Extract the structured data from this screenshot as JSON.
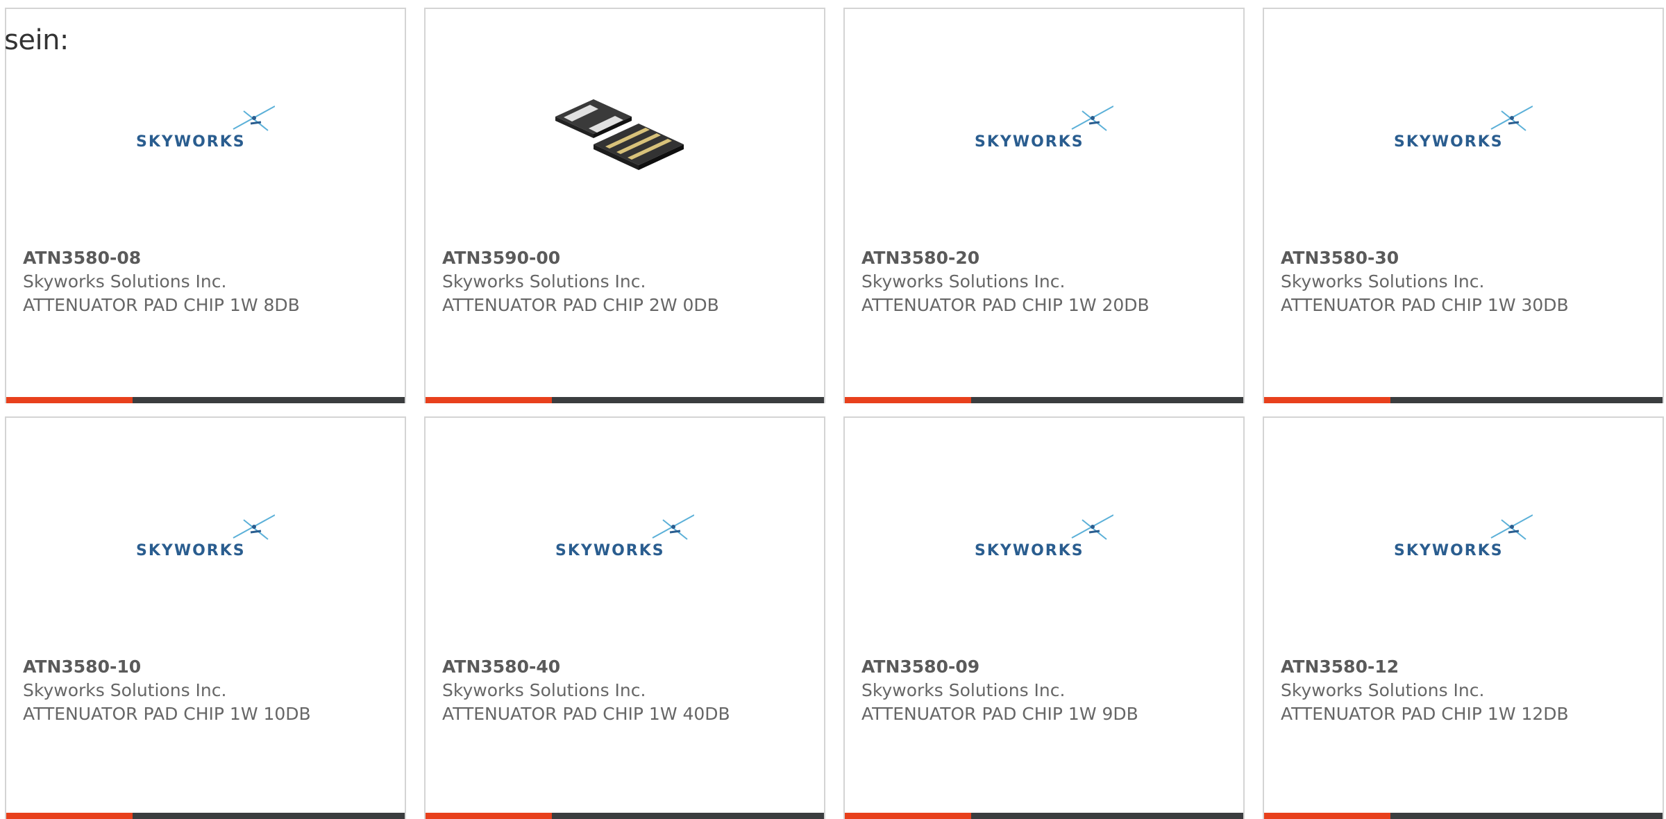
{
  "intro_text": "sein:",
  "brand": "SKYWORKS",
  "colors": {
    "accent": "#e8401c",
    "bar_dark": "#3b3d3f",
    "logo_blue": "#2a5d8f",
    "text": "#666666",
    "border": "#d4d4d4"
  },
  "products": [
    {
      "part_number": "ATN3580-08",
      "manufacturer": "Skyworks Solutions Inc.",
      "description": "ATTENUATOR PAD CHIP 1W 8DB",
      "image": "skyworks-logo"
    },
    {
      "part_number": "ATN3590-00",
      "manufacturer": "Skyworks Solutions Inc.",
      "description": "ATTENUATOR PAD CHIP 2W 0DB",
      "image": "chip-component"
    },
    {
      "part_number": "ATN3580-20",
      "manufacturer": "Skyworks Solutions Inc.",
      "description": "ATTENUATOR PAD CHIP 1W 20DB",
      "image": "skyworks-logo"
    },
    {
      "part_number": "ATN3580-30",
      "manufacturer": "Skyworks Solutions Inc.",
      "description": "ATTENUATOR PAD CHIP 1W 30DB",
      "image": "skyworks-logo"
    },
    {
      "part_number": "ATN3580-10",
      "manufacturer": "Skyworks Solutions Inc.",
      "description": "ATTENUATOR PAD CHIP 1W 10DB",
      "image": "skyworks-logo"
    },
    {
      "part_number": "ATN3580-40",
      "manufacturer": "Skyworks Solutions Inc.",
      "description": "ATTENUATOR PAD CHIP 1W 40DB",
      "image": "skyworks-logo"
    },
    {
      "part_number": "ATN3580-09",
      "manufacturer": "Skyworks Solutions Inc.",
      "description": "ATTENUATOR PAD CHIP 1W 9DB",
      "image": "skyworks-logo"
    },
    {
      "part_number": "ATN3580-12",
      "manufacturer": "Skyworks Solutions Inc.",
      "description": "ATTENUATOR PAD CHIP 1W 12DB",
      "image": "skyworks-logo"
    }
  ]
}
